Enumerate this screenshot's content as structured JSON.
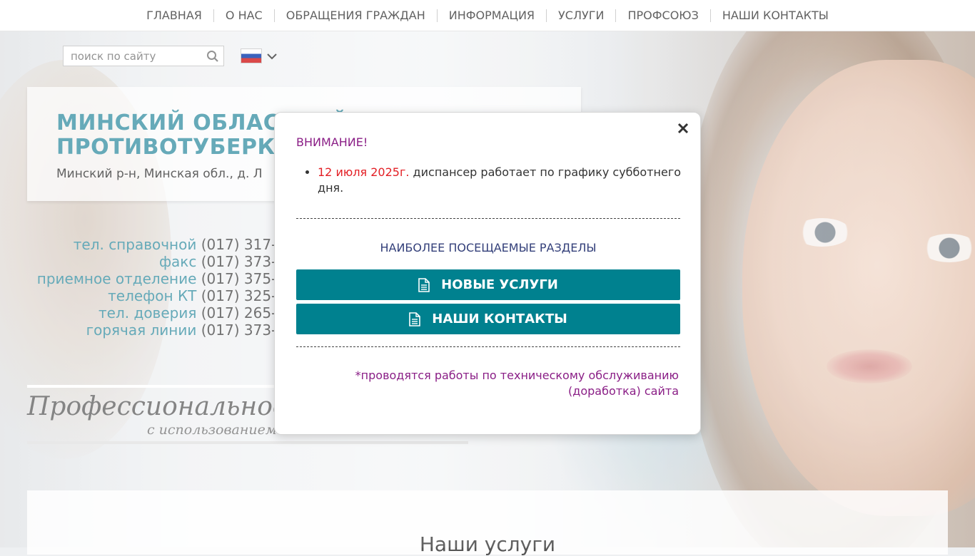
{
  "nav": {
    "items": [
      {
        "label": "ГЛАВНАЯ"
      },
      {
        "label": "О НАС"
      },
      {
        "label": "ОБРАЩЕНИЯ ГРАЖДАН"
      },
      {
        "label": "ИНФОРМАЦИЯ"
      },
      {
        "label": "УСЛУГИ"
      },
      {
        "label": "ПРОФСОЮЗ"
      },
      {
        "label": "НАШИ КОНТАКТЫ"
      }
    ]
  },
  "search": {
    "placeholder": "поиск по сайту",
    "icon": "search-icon"
  },
  "language": {
    "selected": "ru-flag",
    "icon": "chevron-down-icon"
  },
  "header": {
    "org_name": "МИНСКИЙ ОБЛАСТНОЙ\nПРОТИВОТУБЕРКУ",
    "address": "Минский р-н, Минская обл., д. Л"
  },
  "contacts": [
    {
      "label": "тел. справочной",
      "number": "(017) 317-2"
    },
    {
      "label": "факс",
      "number": "(017) 373-2"
    },
    {
      "label": "приемное отделение",
      "number": "(017) 375-2"
    },
    {
      "label": "телефон КТ",
      "number": "(017) 325-1"
    },
    {
      "label": "тел. доверия",
      "number": "(017) 265-1"
    },
    {
      "label": "горячая линии",
      "number": "(017) 373-2"
    }
  ],
  "slogan": {
    "title": "Профессиональное",
    "subtitle": "с использованием"
  },
  "services": {
    "title": "Наши услуги"
  },
  "modal": {
    "warning": "ВНИМАНИЕ!",
    "notice_date": "12 июля 2025г.",
    "notice_text": " диспансер работает по графику субботнего дня.",
    "popular_title": "НАИБОЛЕЕ ПОСЕЩАЕМЫЕ РАЗДЕЛЫ",
    "button1": "НОВЫЕ УСЛУГИ",
    "button2": "НАШИ КОНТАКТЫ",
    "maintenance": "*проводятся работы по техническому обслуживанию (доработка) сайта",
    "close_icon": "close-icon",
    "doc_icon": "document-icon"
  },
  "colors": {
    "accent_teal": "#00818f",
    "title_teal": "#5aa3b3",
    "warning_purple": "#8a1e86",
    "date_red": "#e31e24"
  }
}
